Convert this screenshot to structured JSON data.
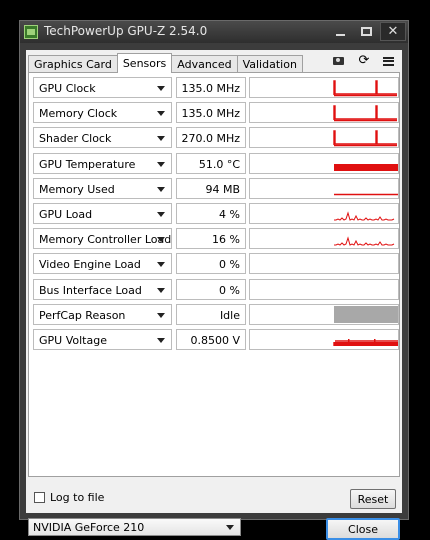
{
  "window": {
    "title": "TechPowerUp GPU-Z 2.54.0"
  },
  "tabs": [
    {
      "label": "Graphics Card",
      "active": false
    },
    {
      "label": "Sensors",
      "active": true
    },
    {
      "label": "Advanced",
      "active": false
    },
    {
      "label": "Validation",
      "active": false
    }
  ],
  "toolbar_icons": [
    "camera-icon",
    "refresh-icon",
    "menu-icon"
  ],
  "sensors": [
    {
      "label": "GPU Clock",
      "value": "135.0 MHz",
      "graph": "spikes"
    },
    {
      "label": "Memory Clock",
      "value": "135.0 MHz",
      "graph": "spikes"
    },
    {
      "label": "Shader Clock",
      "value": "270.0 MHz",
      "graph": "spikes"
    },
    {
      "label": "GPU Temperature",
      "value": "51.0 °C",
      "graph": "band"
    },
    {
      "label": "Memory Used",
      "value": "94 MB",
      "graph": "line"
    },
    {
      "label": "GPU Load",
      "value": "4 %",
      "graph": "noise"
    },
    {
      "label": "Memory Controller Load",
      "value": "16 %",
      "graph": "noise"
    },
    {
      "label": "Video Engine Load",
      "value": "0 %",
      "graph": "empty"
    },
    {
      "label": "Bus Interface Load",
      "value": "0 %",
      "graph": "empty"
    },
    {
      "label": "PerfCap Reason",
      "value": "Idle",
      "graph": "gray"
    },
    {
      "label": "GPU Voltage",
      "value": "0.8500 V",
      "graph": "steps"
    }
  ],
  "graph_color": "#e01010",
  "perfcap_color": "#a8a8a8",
  "log": {
    "label": "Log to file",
    "checked": false
  },
  "buttons": {
    "reset": "Reset",
    "close": "Close"
  },
  "gpu_select": {
    "value": "NVIDIA GeForce 210"
  }
}
